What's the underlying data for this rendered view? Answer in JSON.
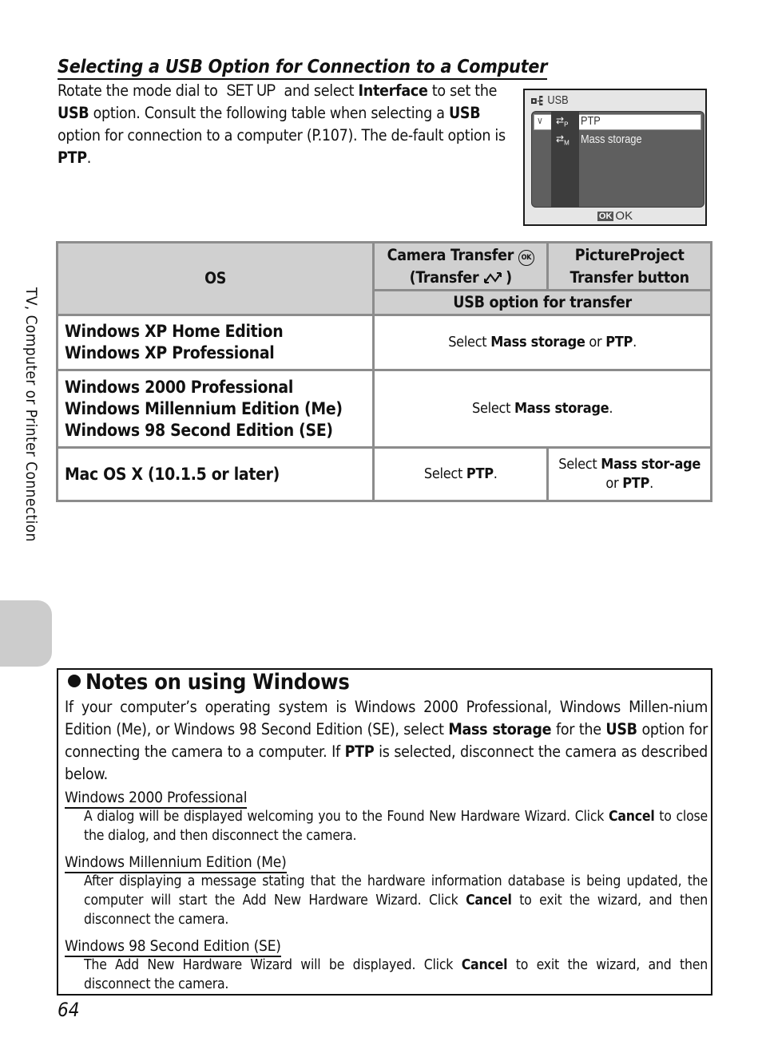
{
  "section": {
    "title": "Selecting a USB Option for Connection to a Computer",
    "intro": {
      "p1": "Rotate the mode dial to ",
      "setup": "SET UP",
      "p2": " and select ",
      "b1": "Interface",
      "p3": " to set the ",
      "b2": "USB",
      "p4": " option. Consult the following table when selecting a ",
      "b3": "USB",
      "p5": " option for connection to a computer (P.107). The de-fault option is ",
      "b4": "PTP",
      "p6": "."
    }
  },
  "lcd": {
    "title": "USB",
    "options": [
      "PTP",
      "Mass storage"
    ],
    "option_badges": [
      "P",
      "M"
    ],
    "selected": "PTP",
    "footer_badge": "OK",
    "footer_label": "OK"
  },
  "table": {
    "header_os": "OS",
    "header_camera_line1": "Camera Transfer ⓪",
    "header_camera_ok": "OK",
    "header_camera_line2": "(Transfer ↗)",
    "header_pp_line1": "PictureProject",
    "header_pp_line2": "Transfer button",
    "subheader": "USB option for transfer",
    "rows": [
      {
        "os": [
          "Windows XP Home Edition",
          "Windows XP Professional"
        ],
        "value": {
          "pre": "Select ",
          "b1": "Mass storage",
          "mid": " or ",
          "b2": "PTP",
          "post": "."
        }
      },
      {
        "os": [
          "Windows 2000 Professional",
          "Windows Millennium Edition (Me)",
          "Windows 98 Second Edition (SE)"
        ],
        "value": {
          "pre": "Select ",
          "b1": "Mass storage",
          "post": "."
        }
      },
      {
        "os": [
          "Mac OS X (10.1.5 or later)"
        ],
        "camera": {
          "pre": "Select ",
          "b1": "PTP",
          "post": "."
        },
        "pictureproject": {
          "pre": "Select ",
          "b1": "Mass stor-age",
          "mid": " or ",
          "b2": "PTP",
          "post": "."
        }
      }
    ]
  },
  "side_tab": {
    "label": "TV, Computer or Printer Connection"
  },
  "notes": {
    "title": "Notes on using Windows",
    "body": {
      "p1": "If your computer’s operating system is Windows 2000 Professional, Windows Millen-nium Edition (Me), or Windows 98 Second Edition (SE), select ",
      "b1": "Mass storage",
      "p2": " for the ",
      "b2": "USB",
      "p3": " option for connecting the camera to a computer. If ",
      "b3": "PTP",
      "p4": " is selected, disconnect the camera as described below."
    },
    "items": [
      {
        "heading": "Windows 2000 Professional",
        "pre": "A dialog will be displayed welcoming you to the Found New Hardware Wizard. Click ",
        "bold": "Cancel",
        "post": " to close the dialog, and then disconnect the camera."
      },
      {
        "heading": "Windows Millennium Edition (Me)",
        "pre": "After displaying a message stating that the hardware information database is being updated, the computer will start the Add New Hardware Wizard. Click ",
        "bold": "Cancel",
        "post": " to exit the wizard, and then disconnect the camera."
      },
      {
        "heading": "Windows 98 Second Edition (SE)",
        "pre": "The Add New Hardware Wizard will be displayed. Click ",
        "bold": "Cancel",
        "post": " to exit the wizard, and then disconnect the camera."
      }
    ]
  },
  "page": {
    "number": "64"
  }
}
